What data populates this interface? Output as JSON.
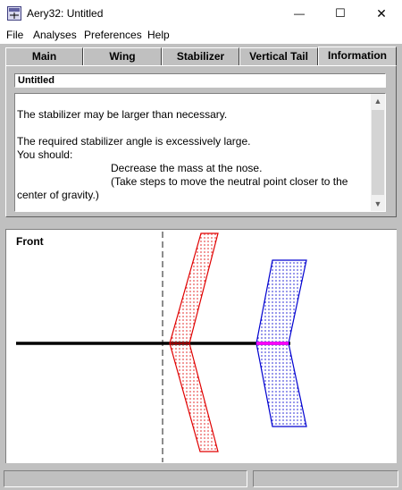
{
  "window": {
    "title": "Aery32:  Untitled",
    "minimize_glyph": "—",
    "maximize_glyph": "☐",
    "close_glyph": "✕"
  },
  "menu": [
    "File",
    "Analyses",
    "Preferences",
    "Help"
  ],
  "tabs": [
    {
      "label": "Main",
      "active": false
    },
    {
      "label": "Wing",
      "active": false
    },
    {
      "label": "Stabilizer",
      "active": false
    },
    {
      "label": "Vertical Tail",
      "active": false
    },
    {
      "label": "Information",
      "active": true
    }
  ],
  "document_name": "Untitled",
  "info_lines": [
    "The stabilizer may be larger than necessary.",
    "",
    "The required stabilizer angle is excessively large.",
    "You should:",
    "Decrease the mass at the nose.",
    "(Take steps to move the neutral point closer to the",
    "center of gravity.)"
  ],
  "plot": {
    "view_label": "Front",
    "colors": {
      "wing": "#e00000",
      "stabilizer": "#0000d0",
      "fuselage": "#000000",
      "marker": "#ff00ff",
      "centerline": "#404040"
    }
  },
  "icons": {
    "app": "aircraft-app-icon",
    "scroll_up": "chevron-up-icon",
    "scroll_down": "chevron-down-icon"
  }
}
